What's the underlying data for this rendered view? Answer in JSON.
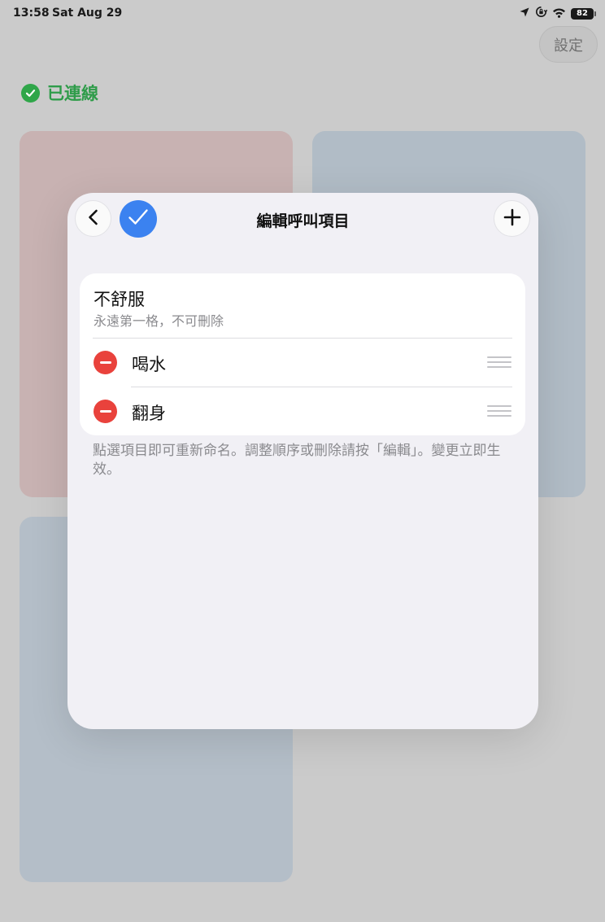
{
  "status_bar": {
    "time": "13:58",
    "date": "Sat Aug 29",
    "battery": "82",
    "icons": [
      "location-arrow-icon",
      "orientation-lock-icon",
      "wifi-icon",
      "battery-icon"
    ]
  },
  "header": {
    "settings_label": "設定",
    "connection_label": "已連線",
    "connection_icon": "check-circle-icon"
  },
  "colors": {
    "accent_blue": "#3b82f0",
    "delete_red": "#e9423c",
    "connected_green": "#2fa649",
    "tile_pink": "#c8b2b2",
    "tile_blue": "#b1bcc6"
  },
  "sheet": {
    "title": "編輯呼叫項目",
    "back_icon": "chevron-left-icon",
    "done_icon": "checkmark-icon",
    "add_icon": "plus-icon",
    "fixed_item": {
      "title": "不舒服",
      "subtitle": "永遠第一格，不可刪除"
    },
    "items": [
      {
        "label": "喝水",
        "delete_icon": "minus-circle-icon",
        "reorder_icon": "drag-handle-icon"
      },
      {
        "label": "翻身",
        "delete_icon": "minus-circle-icon",
        "reorder_icon": "drag-handle-icon"
      }
    ],
    "footer_note": "點選項目即可重新命名。調整順序或刪除請按「編輯」。變更立即生效。"
  }
}
